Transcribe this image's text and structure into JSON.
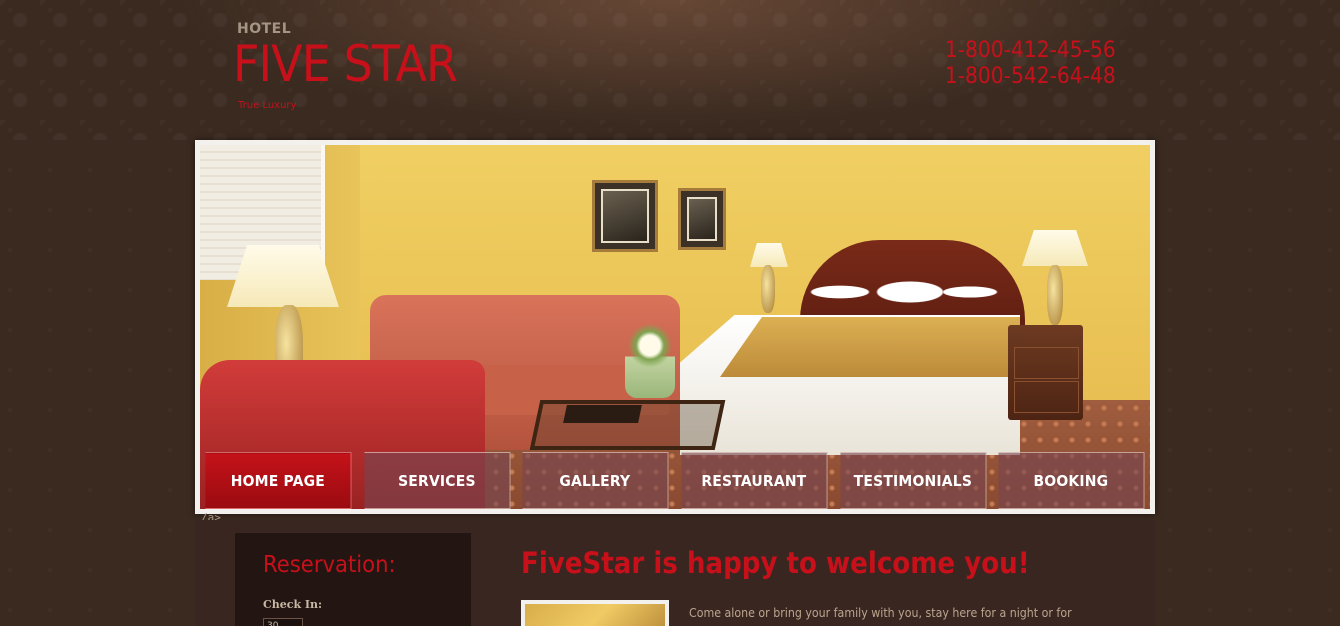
{
  "header": {
    "logo_hotel": "HOTEL",
    "logo_title": "FIVE STAR",
    "logo_tagline": "True Luxury",
    "phones": [
      "1-800-412-45-56",
      "1-800-542-64-48"
    ]
  },
  "nav": {
    "items": [
      {
        "label": "HOME PAGE",
        "active": true
      },
      {
        "label": "SERVICES",
        "active": false
      },
      {
        "label": "GALLERY",
        "active": false
      },
      {
        "label": "RESTAURANT",
        "active": false
      },
      {
        "label": "TESTIMONIALS",
        "active": false
      },
      {
        "label": "BOOKING",
        "active": false
      }
    ]
  },
  "stray_text": "/a>",
  "sidebar": {
    "title": "Reservation:",
    "checkin_label": "Check In:",
    "checkin_value": "30"
  },
  "main": {
    "welcome_title": "FiveStar is happy to welcome you!",
    "welcome_text": "Come alone or bring your family with you, stay here for a night or for weeks,"
  },
  "colors": {
    "brand_red": "#c8101b",
    "background": "#3a2a20",
    "nav_inactive": "#784650"
  }
}
